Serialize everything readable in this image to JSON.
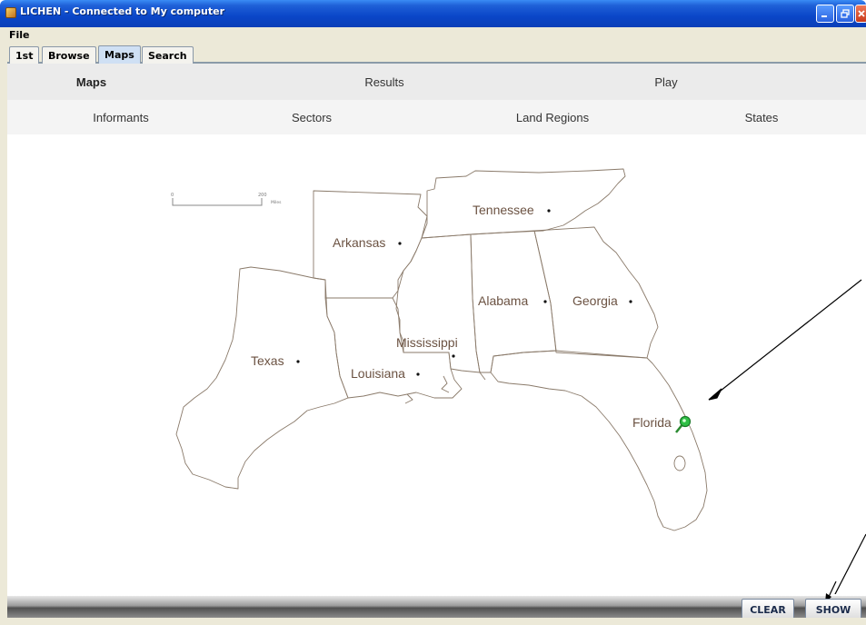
{
  "window": {
    "title": "LICHEN - Connected to My computer",
    "controls": [
      "minimize-icon",
      "restore-icon",
      "close-icon"
    ],
    "title_color": "#0a46c8"
  },
  "menubar": {
    "file_label": "File"
  },
  "tabs": [
    {
      "label": "1st",
      "active": false
    },
    {
      "label": "Browse",
      "active": false
    },
    {
      "label": "Maps",
      "active": true
    },
    {
      "label": "Search",
      "active": false
    }
  ],
  "nav_primary": [
    {
      "label": "Maps",
      "selected": true
    },
    {
      "label": "Results",
      "selected": false
    },
    {
      "label": "Play",
      "selected": false
    }
  ],
  "nav_secondary": [
    {
      "label": "Informants"
    },
    {
      "label": "Sectors"
    },
    {
      "label": "Land Regions"
    },
    {
      "label": "States"
    }
  ],
  "map": {
    "scale_bar": {
      "start": "0",
      "end": "200",
      "unit": "Miles"
    },
    "states": [
      "Tennessee",
      "Arkansas",
      "Alabama",
      "Georgia",
      "Mississippi",
      "Texas",
      "Louisiana",
      "Florida"
    ],
    "pin": {
      "state": "Florida",
      "icon": "map-pin-icon",
      "color": "#22a83a"
    },
    "border_color": "#7a6a5a",
    "label_color": "#6b5242"
  },
  "bottom_bar": {
    "clear_label": "CLEAR",
    "show_label": "SHOW"
  }
}
